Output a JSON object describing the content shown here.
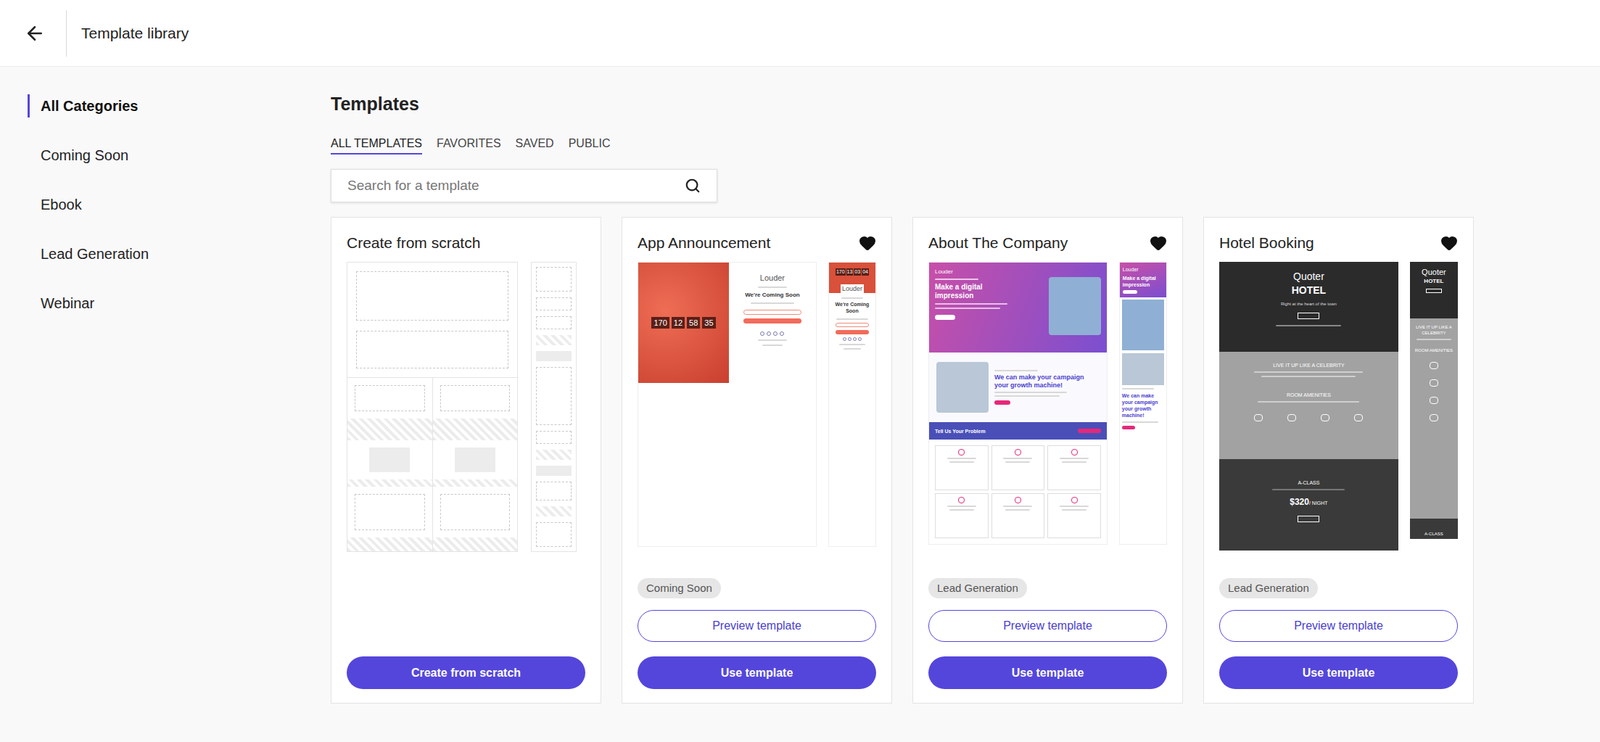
{
  "header": {
    "title": "Template library"
  },
  "sidebar": {
    "items": [
      {
        "label": "All Categories",
        "selected": true
      },
      {
        "label": "Coming Soon",
        "selected": false
      },
      {
        "label": "Ebook",
        "selected": false
      },
      {
        "label": "Lead Generation",
        "selected": false
      },
      {
        "label": "Webinar",
        "selected": false
      }
    ]
  },
  "main": {
    "title": "Templates"
  },
  "tabs": [
    {
      "label": "ALL TEMPLATES",
      "selected": true
    },
    {
      "label": "FAVORITES",
      "selected": false
    },
    {
      "label": "SAVED",
      "selected": false
    },
    {
      "label": "PUBLIC",
      "selected": false
    }
  ],
  "search": {
    "placeholder": "Search for a template"
  },
  "cards": [
    {
      "kind": "scratch",
      "title": "Create from scratch",
      "button": "Create from scratch"
    },
    {
      "kind": "template",
      "title": "App Announcement",
      "favorite": true,
      "tag": "Coming Soon",
      "preview_button": "Preview template",
      "button": "Use template",
      "thumbnail": {
        "kind": "countdown",
        "brand": "Louder",
        "heading": "We're Coming Soon",
        "countdown": [
          "170",
          "12",
          "58",
          "35"
        ],
        "mobile_countdown": [
          "170",
          "13",
          "03",
          "04"
        ]
      }
    },
    {
      "kind": "template",
      "title": "About The Company",
      "favorite": true,
      "tag": "Lead Generation",
      "preview_button": "Preview template",
      "button": "Use template",
      "thumbnail": {
        "kind": "company",
        "brand": "Louder",
        "hero": "Make a digital impression",
        "section": "We can make your campaign your growth machine!",
        "banner": "Tell Us Your Problem"
      }
    },
    {
      "kind": "template",
      "title": "Hotel Booking",
      "favorite": true,
      "tag": "Lead Generation",
      "preview_button": "Preview template",
      "button": "Use template",
      "thumbnail": {
        "kind": "hotel",
        "brand": "Quoter",
        "name": "HOTEL",
        "tagline": "Right at the heart of the town",
        "section": "LIVE IT UP LIKE A CELEBRITY",
        "amenities": "ROOM AMENITIES",
        "room": "A-CLASS",
        "price": "$320",
        "unit": "/ NIGHT"
      }
    }
  ]
}
